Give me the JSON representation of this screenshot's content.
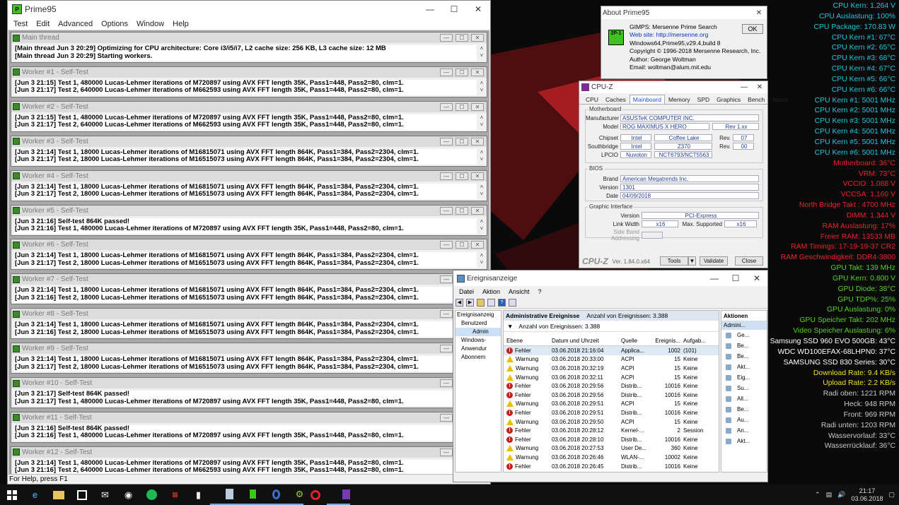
{
  "prime95": {
    "title": "Prime95",
    "menu": [
      "Test",
      "Edit",
      "Advanced",
      "Options",
      "Window",
      "Help"
    ],
    "status": "For Help, press F1",
    "windows": [
      {
        "title": "Main thread",
        "lines": [
          "[Main thread Jun 3 20:29] Optimizing for CPU architecture: Core i3/i5/i7, L2 cache size: 256 KB, L3 cache size: 12 MB",
          "[Main thread Jun 3 20:29] Starting workers."
        ]
      },
      {
        "title": "Worker #1 - Self-Test",
        "lines": [
          "[Jun 3 21:15] Test 1, 480000 Lucas-Lehmer iterations of M720897 using AVX FFT length 35K, Pass1=448, Pass2=80, clm=1.",
          "[Jun 3 21:17] Test 2, 640000 Lucas-Lehmer iterations of M662593 using AVX FFT length 35K, Pass1=448, Pass2=80, clm=1."
        ]
      },
      {
        "title": "Worker #2 - Self-Test",
        "lines": [
          "[Jun 3 21:15] Test 1, 480000 Lucas-Lehmer iterations of M720897 using AVX FFT length 35K, Pass1=448, Pass2=80, clm=1.",
          "[Jun 3 21:17] Test 2, 640000 Lucas-Lehmer iterations of M662593 using AVX FFT length 35K, Pass1=448, Pass2=80, clm=1."
        ]
      },
      {
        "title": "Worker #3 - Self-Test",
        "lines": [
          "[Jun 3 21:14] Test 1, 18000 Lucas-Lehmer iterations of M16815071 using AVX FFT length 864K, Pass1=384, Pass2=2304, clm=1.",
          "[Jun 3 21:17] Test 2, 18000 Lucas-Lehmer iterations of M16515073 using AVX FFT length 864K, Pass1=384, Pass2=2304, clm=1."
        ]
      },
      {
        "title": "Worker #4 - Self-Test",
        "lines": [
          "[Jun 3 21:14] Test 1, 18000 Lucas-Lehmer iterations of M16815071 using AVX FFT length 864K, Pass1=384, Pass2=2304, clm=1.",
          "[Jun 3 21:17] Test 2, 18000 Lucas-Lehmer iterations of M16515073 using AVX FFT length 864K, Pass1=384, Pass2=2304, clm=1."
        ]
      },
      {
        "title": "Worker #5 - Self-Test",
        "lines": [
          "[Jun 3 21:16] Self-test 864K passed!",
          "[Jun 3 21:16] Test 1, 480000 Lucas-Lehmer iterations of M720897 using AVX FFT length 35K, Pass1=448, Pass2=80, clm=1."
        ]
      },
      {
        "title": "Worker #6 - Self-Test",
        "lines": [
          "[Jun 3 21:14] Test 1, 18000 Lucas-Lehmer iterations of M16815071 using AVX FFT length 864K, Pass1=384, Pass2=2304, clm=1.",
          "[Jun 3 21:17] Test 2, 18000 Lucas-Lehmer iterations of M16515073 using AVX FFT length 864K, Pass1=384, Pass2=2304, clm=1."
        ]
      },
      {
        "title": "Worker #7 - Self-Test",
        "lines": [
          "[Jun 3 21:14] Test 1, 18000 Lucas-Lehmer iterations of M16815071 using AVX FFT length 864K, Pass1=384, Pass2=2304, clm=1.",
          "[Jun 3 21:16] Test 2, 18000 Lucas-Lehmer iterations of M16515073 using AVX FFT length 864K, Pass1=384, Pass2=2304, clm=1."
        ]
      },
      {
        "title": "Worker #8 - Self-Test",
        "lines": [
          "[Jun 3 21:14] Test 1, 18000 Lucas-Lehmer iterations of M16815071 using AVX FFT length 864K, Pass1=384, Pass2=2304, clm=1.",
          "[Jun 3 21:16] Test 2, 18000 Lucas-Lehmer iterations of M16515073 using AVX FFT length 864K, Pass1=384, Pass2=2304, clm=1."
        ]
      },
      {
        "title": "Worker #9 - Self-Test",
        "lines": [
          "[Jun 3 21:14] Test 1, 18000 Lucas-Lehmer iterations of M16815071 using AVX FFT length 864K, Pass1=384, Pass2=2304, clm=1.",
          "[Jun 3 21:17] Test 2, 18000 Lucas-Lehmer iterations of M16515073 using AVX FFT length 864K, Pass1=384, Pass2=2304, clm=1."
        ]
      },
      {
        "title": "Worker #10 - Self-Test",
        "lines": [
          "[Jun 3 21:17] Self-test 864K passed!",
          "[Jun 3 21:17] Test 1, 480000 Lucas-Lehmer iterations of M720897 using AVX FFT length 35K, Pass1=448, Pass2=80, clm=1."
        ]
      },
      {
        "title": "Worker #11 - Self-Test",
        "lines": [
          "[Jun 3 21:16] Self-test 864K passed!",
          "[Jun 3 21:16] Test 1, 480000 Lucas-Lehmer iterations of M720897 using AVX FFT length 35K, Pass1=448, Pass2=80, clm=1."
        ]
      },
      {
        "title": "Worker #12 - Self-Test",
        "lines": [
          "[Jun 3 21:14] Test 1, 480000 Lucas-Lehmer iterations of M720897 using AVX FFT length 35K, Pass1=448, Pass2=80, clm=1.",
          "[Jun 3 21:16] Test 2, 640000 Lucas-Lehmer iterations of M662593 using AVX FFT length 35K, Pass1=448, Pass2=80, clm=1."
        ]
      }
    ]
  },
  "about": {
    "title": "About Prime95",
    "ok": "OK",
    "icon_text": "2P-1",
    "lines": [
      "GIMPS: Mersenne Prime Search",
      "Web site: http://mersenne.org",
      "Windows64,Prime95,v29.4,build 8",
      "Copyright © 1996-2018 Mersenne Research, Inc.",
      "Author: George Woltman",
      "Email: woltman@alum.mit.edu"
    ]
  },
  "cpuz": {
    "title": "CPU-Z",
    "tabs": [
      "CPU",
      "Caches",
      "Mainboard",
      "Memory",
      "SPD",
      "Graphics",
      "Bench",
      "About"
    ],
    "mb_label": "Motherboard",
    "manufacturer_l": "Manufacturer",
    "manufacturer": "ASUSTeK COMPUTER INC.",
    "model_l": "Model",
    "model": "ROG MAXIMUS X HERO",
    "model_rev": "Rev 1.xx",
    "chipset_l": "Chipset",
    "chipset_v": "Intel",
    "chipset_n": "Coffee Lake",
    "chipset_rev_l": "Rev.",
    "chipset_rev": "07",
    "south_l": "Southbridge",
    "south_v": "Intel",
    "south_n": "Z370",
    "south_rev": "00",
    "lpcio_l": "LPCIO",
    "lpcio_v": "Nuvoton",
    "lpcio_n": "NCT6793/NCT5563",
    "bios_label": "BIOS",
    "brand_l": "Brand",
    "brand": "American Megatrends Inc.",
    "version_l": "Version",
    "version": "1301",
    "date_l": "Date",
    "date": "04/09/2018",
    "gi_label": "Graphic Interface",
    "gi_version_l": "Version",
    "gi_version": "PCI-Express",
    "lw_l": "Link Width",
    "lw": "x16",
    "ms_l": "Max. Supported",
    "ms": "x16",
    "sba_l": "Side Band Addressing",
    "logo": "CPU-Z",
    "ver": "Ver. 1.84.0.x64",
    "tools": "Tools",
    "validate": "Validate",
    "close": "Close"
  },
  "events": {
    "title": "Ereignisanzeige",
    "menu": [
      "Datei",
      "Aktion",
      "Ansicht",
      "?"
    ],
    "tree": [
      "Ereignisanzeig",
      "Benutzerd",
      "Admin",
      "Windows-",
      "Anwendur",
      "Abonnem"
    ],
    "header": "Administrative Ereignisse",
    "header_count": "Anzahl von Ereignissen: 3.388",
    "filter": "Anzahl von Ereignissen: 3.388",
    "columns": [
      "Ebene",
      "Datum und Uhrzeit",
      "Quelle",
      "Ereignis...",
      "Aufgab..."
    ],
    "rows": [
      {
        "level": "Fehler",
        "type": "err",
        "date": "03.06.2018 21:16:04",
        "source": "Applica...",
        "id": "1002",
        "task": "(101)"
      },
      {
        "level": "Warnung",
        "type": "warn",
        "date": "03.06.2018 20:33:00",
        "source": "ACPI",
        "id": "15",
        "task": "Keine"
      },
      {
        "level": "Warnung",
        "type": "warn",
        "date": "03.06.2018 20:32:19",
        "source": "ACPI",
        "id": "15",
        "task": "Keine"
      },
      {
        "level": "Warnung",
        "type": "warn",
        "date": "03.06.2018 20:32:11",
        "source": "ACPI",
        "id": "15",
        "task": "Keine"
      },
      {
        "level": "Fehler",
        "type": "err",
        "date": "03.06.2018 20:29:56",
        "source": "Distrib...",
        "id": "10016",
        "task": "Keine"
      },
      {
        "level": "Fehler",
        "type": "err",
        "date": "03.06.2018 20:29:56",
        "source": "Distrib...",
        "id": "10016",
        "task": "Keine"
      },
      {
        "level": "Warnung",
        "type": "warn",
        "date": "03.06.2018 20:29:51",
        "source": "ACPI",
        "id": "15",
        "task": "Keine"
      },
      {
        "level": "Fehler",
        "type": "err",
        "date": "03.06.2018 20:29:51",
        "source": "Distrib...",
        "id": "10016",
        "task": "Keine"
      },
      {
        "level": "Warnung",
        "type": "warn",
        "date": "03.06.2018 20:29:50",
        "source": "ACPI",
        "id": "15",
        "task": "Keine"
      },
      {
        "level": "Fehler",
        "type": "err",
        "date": "03.06.2018 20:28:12",
        "source": "Kernel-...",
        "id": "2",
        "task": "Session"
      },
      {
        "level": "Fehler",
        "type": "err",
        "date": "03.06.2018 20:28:10",
        "source": "Distrib...",
        "id": "10016",
        "task": "Keine"
      },
      {
        "level": "Warnung",
        "type": "warn",
        "date": "03.06.2018 20:27:53",
        "source": "User De...",
        "id": "360",
        "task": "Keine"
      },
      {
        "level": "Warnung",
        "type": "warn",
        "date": "03.06.2018 20:26:46",
        "source": "WLAN-...",
        "id": "10002",
        "task": "Keine"
      },
      {
        "level": "Fehler",
        "type": "err",
        "date": "03.06.2018 20:26:45",
        "source": "Distrib...",
        "id": "10016",
        "task": "Keine"
      }
    ],
    "actions_title": "Aktionen",
    "actions_sub": "Admini...",
    "actions": [
      "Ge...",
      "Be...",
      "Be...",
      "Akt...",
      "Eig...",
      "Su...",
      "All...",
      "Be...",
      "Au...",
      "An...",
      "Akt..."
    ]
  },
  "overlay": [
    {
      "t": "CPU Kern: 1.264 V",
      "c": "#22c6e0"
    },
    {
      "t": "CPU Auslastung: 100%",
      "c": "#22c6e0"
    },
    {
      "t": "CPU Package: 170.83 W",
      "c": "#22c6e0"
    },
    {
      "t": "CPU Kern #1: 67°C",
      "c": "#22c6e0"
    },
    {
      "t": "CPU Kern #2: 65°C",
      "c": "#22c6e0"
    },
    {
      "t": "CPU Kern #3: 68°C",
      "c": "#22c6e0"
    },
    {
      "t": "CPU Kern #4: 67°C",
      "c": "#22c6e0"
    },
    {
      "t": "CPU Kern #5: 66°C",
      "c": "#22c6e0"
    },
    {
      "t": "CPU Kern #6: 66°C",
      "c": "#22c6e0"
    },
    {
      "t": "CPU Kern #1: 5001 MHz",
      "c": "#22c6e0"
    },
    {
      "t": "CPU Kern #2: 5001 MHz",
      "c": "#22c6e0"
    },
    {
      "t": "CPU Kern #3: 5001 MHz",
      "c": "#22c6e0"
    },
    {
      "t": "CPU Kern #4: 5001 MHz",
      "c": "#22c6e0"
    },
    {
      "t": "CPU Kern #5: 5001 MHz",
      "c": "#22c6e0"
    },
    {
      "t": "CPU Kern #6: 5001 MHz",
      "c": "#22c6e0"
    },
    {
      "t": "Motherboard: 36°C",
      "c": "#e8262b"
    },
    {
      "t": "VRM: 73°C",
      "c": "#e8262b"
    },
    {
      "t": "VCCIO: 1.088 V",
      "c": "#e8262b"
    },
    {
      "t": "VCCSA: 1.160 V",
      "c": "#e8262b"
    },
    {
      "t": "North Bridge Takt : 4700 MHz",
      "c": "#e8262b"
    },
    {
      "t": "DIMM: 1.344 V",
      "c": "#e8262b"
    },
    {
      "t": "RAM Auslastung: 17%",
      "c": "#e8262b"
    },
    {
      "t": "Freier RAM: 13533 MB",
      "c": "#e8262b"
    },
    {
      "t": "RAM Timings: 17-19-19-37 CR2",
      "c": "#e8262b"
    },
    {
      "t": "RAM Geschwindigkeit: DDR4-3800",
      "c": "#e8262b"
    },
    {
      "t": "GPU Takt: 139 MHz",
      "c": "#55d21c"
    },
    {
      "t": "GPU Kern: 0.800 V",
      "c": "#55d21c"
    },
    {
      "t": "GPU Diode: 38°C",
      "c": "#55d21c"
    },
    {
      "t": "GPU TDP%: 25%",
      "c": "#55d21c"
    },
    {
      "t": "GPU Auslastung: 0%",
      "c": "#55d21c"
    },
    {
      "t": "GPU Speicher Takt: 202 MHz",
      "c": "#55d21c"
    },
    {
      "t": "Video Speicher Auslastung: 6%",
      "c": "#55d21c"
    },
    {
      "t": "Samsung SSD 960 EVO 500GB: 43°C",
      "c": "#ffffff"
    },
    {
      "t": "WDC WD100EFAX-68LHPN0: 37°C",
      "c": "#ffffff"
    },
    {
      "t": "SAMSUNG SSD 830 Series: 30°C",
      "c": "#ffffff"
    },
    {
      "t": "Download Rate: 9.4 KB/s",
      "c": "#f0e020"
    },
    {
      "t": "Upload Rate: 2.2 KB/s",
      "c": "#f0e020"
    },
    {
      "t": "Radi oben: 1221 RPM",
      "c": "#c8c8c8"
    },
    {
      "t": "Heck: 948 RPM",
      "c": "#c8c8c8"
    },
    {
      "t": "Front: 969 RPM",
      "c": "#c8c8c8"
    },
    {
      "t": "Radi unten: 1203 RPM",
      "c": "#c8c8c8"
    },
    {
      "t": "Wasservorlauf: 33°C",
      "c": "#c8c8c8"
    },
    {
      "t": "Wasserrücklauf: 36°C",
      "c": "#c8c8c8"
    }
  ],
  "taskbar": {
    "icons": [
      "windows-start-icon",
      "edge-icon",
      "explorer-icon",
      "store-icon",
      "mail-icon",
      "media-icon",
      "spotify-icon",
      "calculator-icon",
      "usb-icon",
      "notepad-icon",
      "prime95-icon",
      "cpuid-icon",
      "hwinfo-icon",
      "opera-icon",
      "app-icon"
    ],
    "time": "21:17",
    "date": "03.06.2018"
  }
}
